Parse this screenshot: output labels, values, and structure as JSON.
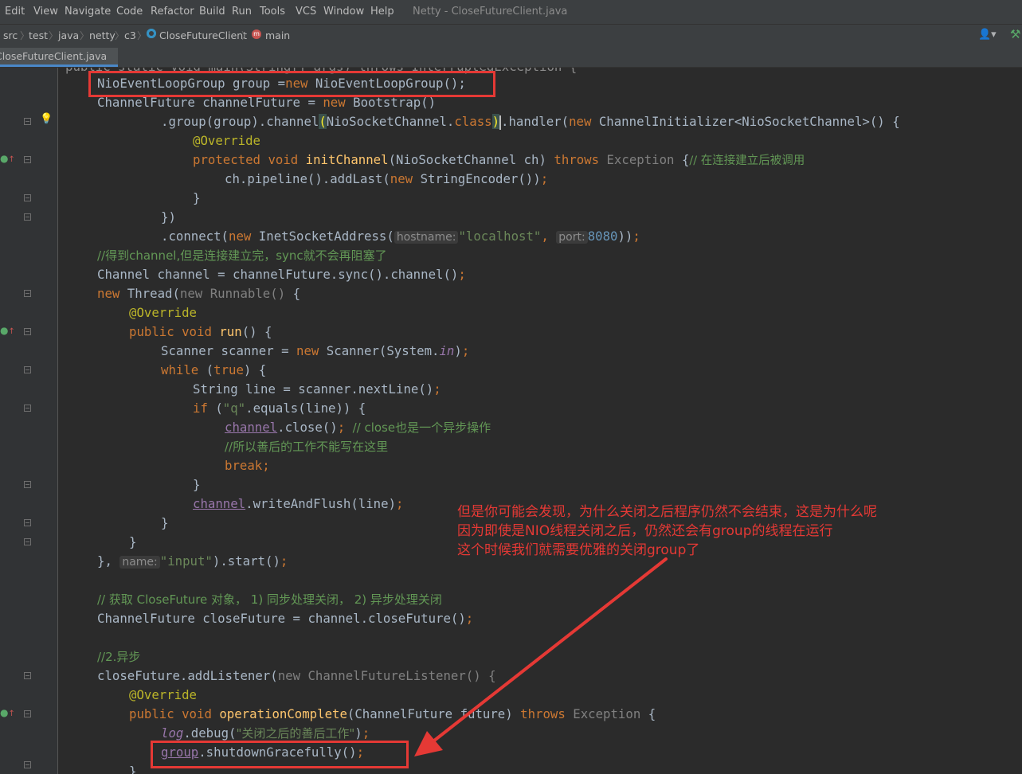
{
  "menu": {
    "items": [
      "Edit",
      "View",
      "Navigate",
      "Code",
      "Refactor",
      "Build",
      "Run",
      "Tools",
      "VCS",
      "Window",
      "Help"
    ],
    "window_title": "Netty - CloseFutureClient.java"
  },
  "breadcrumb": [
    "src",
    "test",
    "java",
    "netty",
    "c3",
    "CloseFutureClient",
    "main"
  ],
  "tab": {
    "label": "CloseFutureClient.java"
  },
  "colors": {
    "keyword": "#cc7832",
    "annotation": "#bbb529",
    "string": "#6a8759",
    "highlight_box": "#e53935"
  },
  "icons": [
    "class-icon",
    "method-icon",
    "user-icon",
    "hammer-icon",
    "lightbulb-icon",
    "override-icon",
    "fold-icon",
    "arrow-icon"
  ],
  "code": {
    "l0": "public static void main(String[] args) throws InterruptedException {",
    "l1_type": "NioEventLoopGroup group =",
    "l1_new": "new",
    "l1_rest": " NioEventLoopGroup();",
    "l2_a": "ChannelFuture channelFuture = ",
    "l2_new": "new",
    "l2_b": " Bootstrap()",
    "l3_a": ".group(group).channel",
    "l3_paren": "(",
    "l3_b": "NioSocketChannel.",
    "l3_class": "class",
    "l3_paren2": ")",
    "l3_c": ".handler(",
    "l3_new": "new",
    "l3_d": " ChannelInitializer<NioSocketChannel>() {",
    "l4": "@Override",
    "l5_prot": "protected void ",
    "l5_fn": "initChannel",
    "l5_a": "(NioSocketChannel ch) ",
    "l5_throws": "throws",
    "l5_exc": " Exception ",
    "l5_b": "{",
    "l5_cm": "// 在连接建立后被调用",
    "l6_a": "ch.pipeline().addLast(",
    "l6_new": "new",
    "l6_b": " StringEncoder())",
    "l6_semi": ";",
    "l7": "}",
    "l8": "})",
    "l9_a": ".connect(",
    "l9_new": "new",
    "l9_b": " InetSocketAddress(",
    "l9_hint1": "hostname:",
    "l9_str": "\"localhost\"",
    "l9_comma": ", ",
    "l9_hint2": "port:",
    "l9_num": "8080",
    "l9_c": "))",
    "l9_semi": ";",
    "l10_cm": "//得到channel,但是连接建立完，sync就不会再阻塞了",
    "l11_a": "Channel channel = channelFuture.sync().channel()",
    "l11_semi": ";",
    "l12_new": "new",
    "l12_a": " Thread(",
    "l12_new2": "new",
    "l12_b": " Runnable() ",
    "l12_c": "{",
    "l13": "@Override",
    "l14_kw": "public void ",
    "l14_fn": "run",
    "l14_a": "() {",
    "l15_a": "Scanner scanner = ",
    "l15_new": "new",
    "l15_b": " Scanner(System.",
    "l15_in": "in",
    "l15_c": ")",
    "l15_semi": ";",
    "l16_kw": "while",
    "l16_a": " (",
    "l16_true": "true",
    "l16_b": ") {",
    "l17_a": "String line = scanner.nextLine()",
    "l17_semi": ";",
    "l18_kw": "if",
    "l18_a": " (",
    "l18_str": "\"q\"",
    "l18_b": ".equals(line)) {",
    "l19_fld": "channel",
    "l19_a": ".close()",
    "l19_semi": "; ",
    "l19_cm": "// close也是一个异步操作",
    "l20_cm": "//所以善后的工作不能写在这里",
    "l21_kw": "break",
    "l21_semi": ";",
    "l22": "}",
    "l23_fld": "channel",
    "l23_a": ".writeAndFlush(line)",
    "l23_semi": ";",
    "l24": "}",
    "l25": "}",
    "l26_a": "}, ",
    "l26_hint": "name:",
    "l26_str": "\"input\"",
    "l26_b": ").start()",
    "l26_semi": ";",
    "l28_cm": "// 获取 CloseFuture 对象， 1) 同步处理关闭， 2) 异步处理关闭",
    "l29_a": "ChannelFuture closeFuture = channel.closeFuture()",
    "l29_semi": ";",
    "l31_cm": "//2.异步",
    "l32_a": "closeFuture.addListener(",
    "l32_gr": "new ChannelFutureListener() {",
    "l33": "@Override",
    "l34_kw": "public void ",
    "l34_fn": "operationComplete",
    "l34_a": "(ChannelFuture future) ",
    "l34_throws": "throws",
    "l34_exc": " Exception ",
    "l34_b": "{",
    "l35_st": "log",
    "l35_a": ".debug(",
    "l35_str": "\"关闭之后的善后工作\"",
    "l35_b": ")",
    "l35_semi": ";",
    "l36_fld": "group",
    "l36_a": ".shutdownGracefully()",
    "l36_semi": ";",
    "l37": "}"
  },
  "annotation": {
    "line1": "但是你可能会发现，为什么关闭之后程序仍然不会结束，这是为什么呢",
    "line2": "因为即使是NIO线程关闭之后，仍然还会有group的线程在运行",
    "line3": "这个时候我们就需要优雅的关闭group了"
  }
}
